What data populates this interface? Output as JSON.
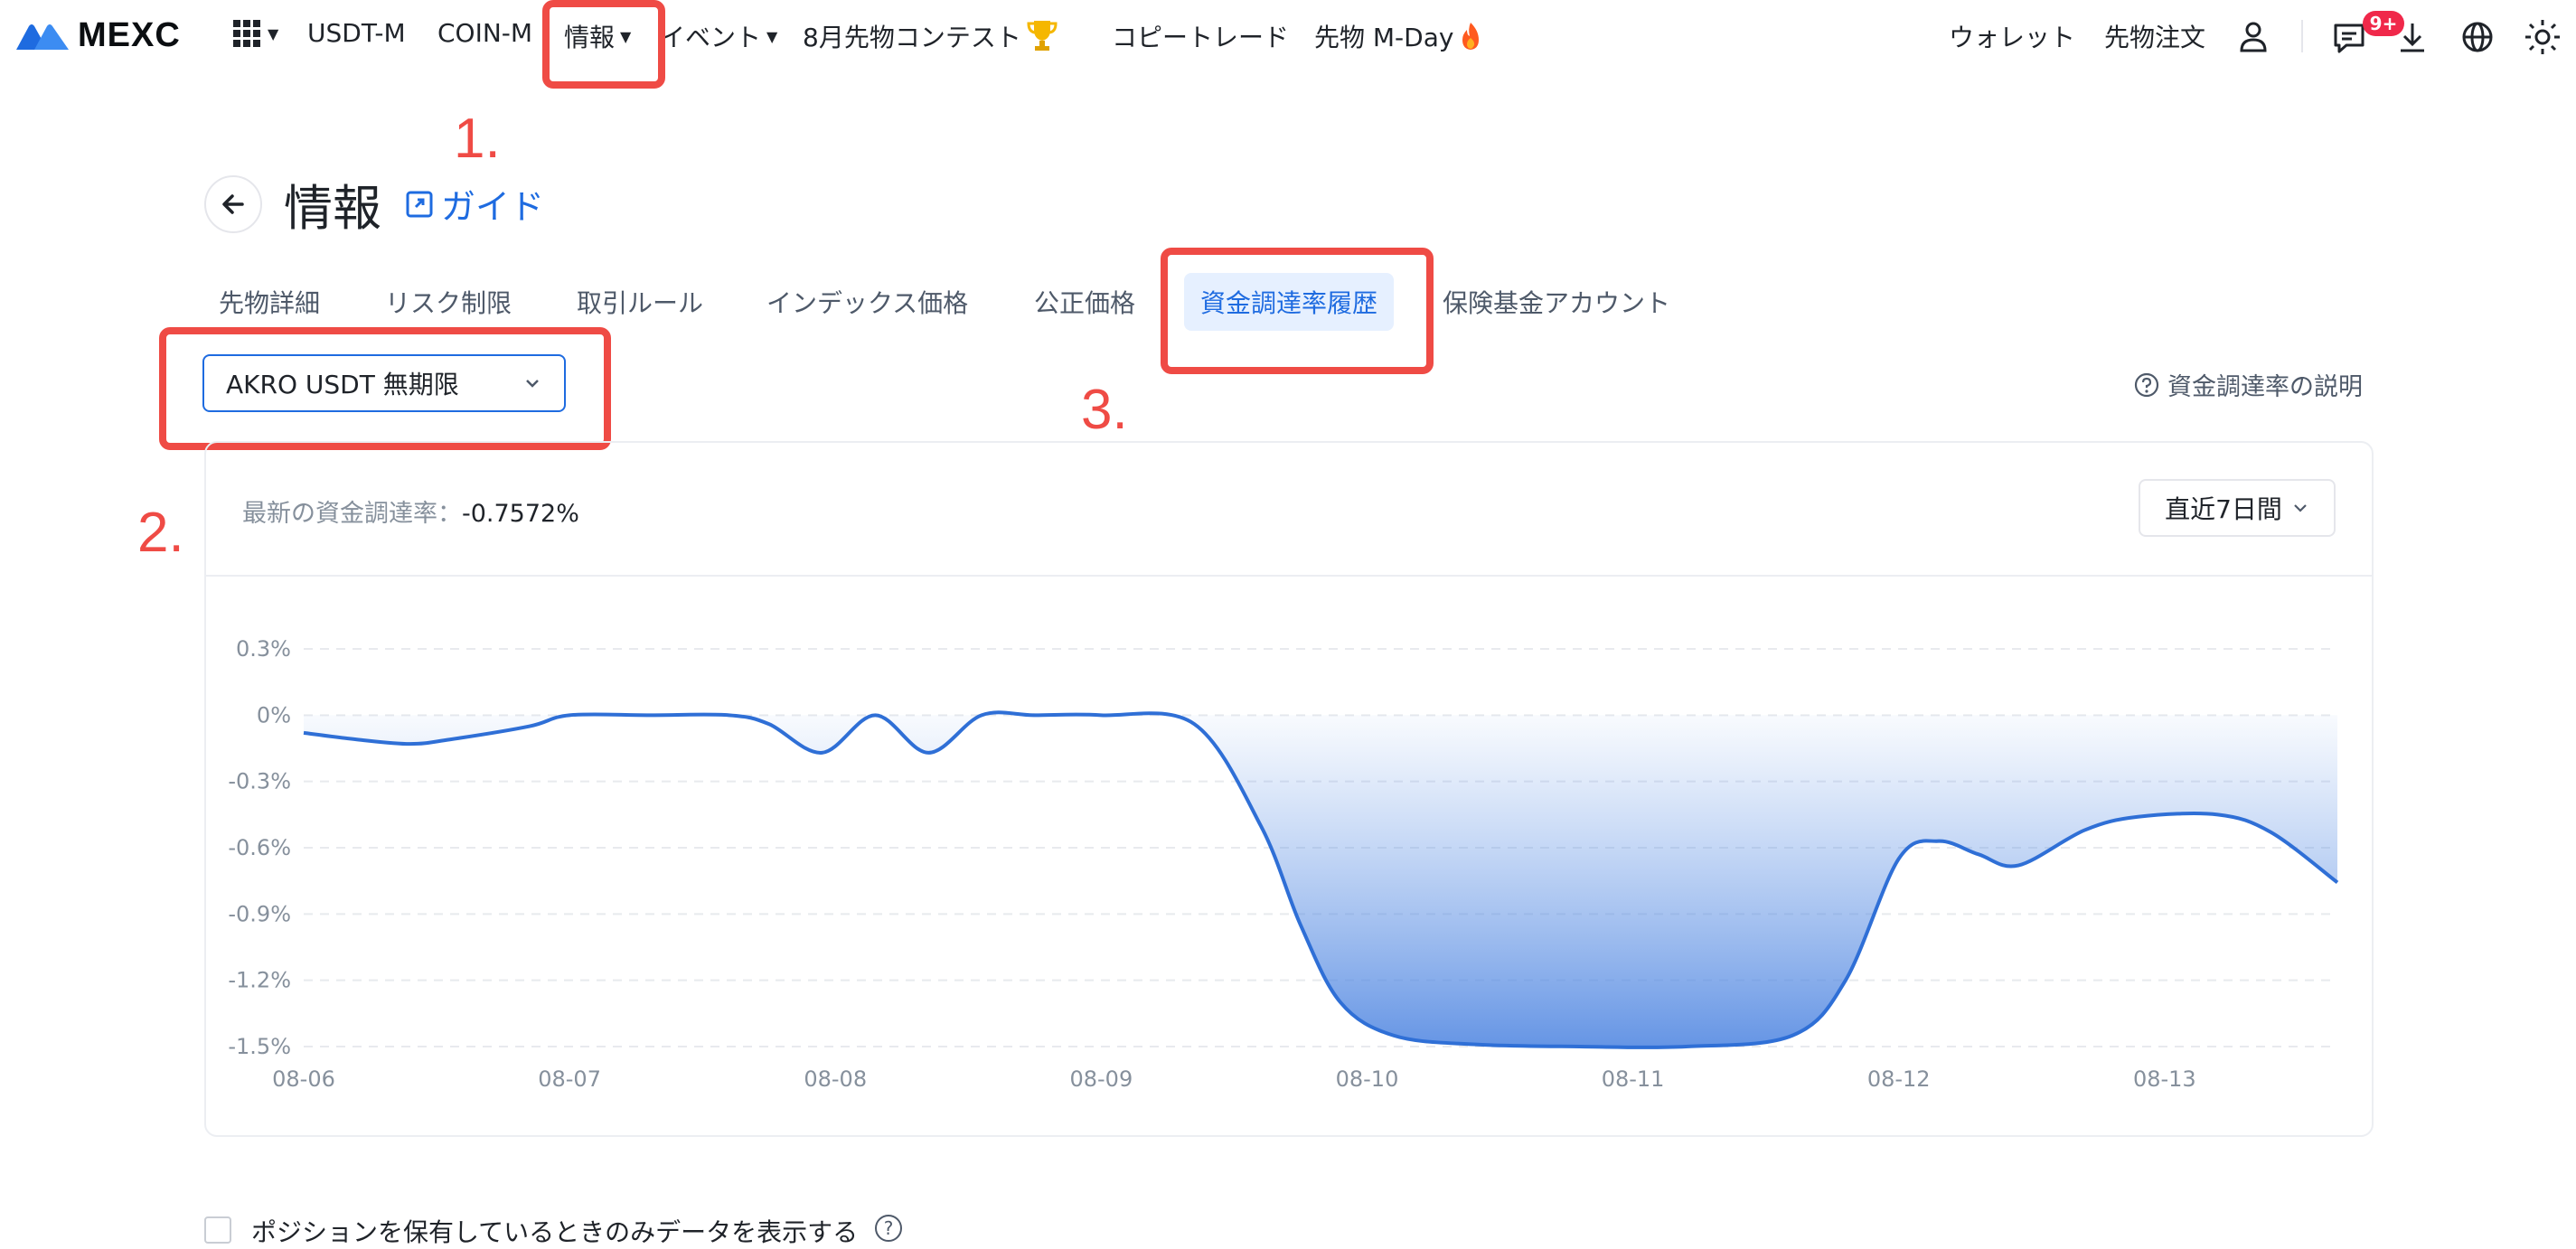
{
  "nav": {
    "logo": "MEXC",
    "items": [
      "USDT-M",
      "COIN-M",
      "情報",
      "イベント",
      "8月先物コンテスト",
      "コピートレード",
      "先物 M-Day"
    ],
    "right": [
      "ウォレット",
      "先物注文"
    ],
    "badge": "9+"
  },
  "annotations": [
    "1.",
    "2.",
    "3."
  ],
  "header": {
    "title": "情報",
    "guide": "ガイド"
  },
  "tabs": [
    "先物詳細",
    "リスク制限",
    "取引ルール",
    "インデックス価格",
    "公正価格",
    "資金調達率履歴",
    "保険基金アカウント"
  ],
  "active_tab_index": 5,
  "symbol_select": {
    "value": "AKRO USDT 無期限"
  },
  "help_link": "資金調達率の説明",
  "latest": {
    "label": "最新の資金調達率：",
    "value": "-0.7572%"
  },
  "period_select": "直近7日間",
  "colors": {
    "accent": "#1e6be0",
    "annotation": "#ef4b45",
    "line": "#2f6fd6"
  },
  "chart_data": {
    "type": "area",
    "x_ticks": [
      "08-06",
      "08-07",
      "08-08",
      "08-09",
      "08-10",
      "08-11",
      "08-12",
      "08-13"
    ],
    "y_ticks": [
      "0.3%",
      "0%",
      "-0.3%",
      "-0.6%",
      "-0.9%",
      "-1.2%",
      "-1.5%"
    ],
    "ylim": [
      -1.5,
      0.3
    ],
    "x": [
      0,
      0.2,
      0.4,
      0.55,
      0.85,
      1.0,
      1.3,
      1.6,
      1.75,
      1.95,
      2.15,
      2.35,
      2.55,
      2.75,
      3.0,
      3.35,
      3.6,
      3.75,
      3.9,
      4.1,
      4.4,
      4.8,
      5.2,
      5.6,
      5.8,
      6.0,
      6.15,
      6.3,
      6.45,
      6.7,
      6.9,
      7.2,
      7.4,
      7.65
    ],
    "values": [
      -0.08,
      -0.11,
      -0.13,
      -0.11,
      -0.05,
      0.0,
      0.0,
      0.0,
      -0.04,
      -0.17,
      0.0,
      -0.17,
      0.0,
      0.0,
      0.0,
      -0.04,
      -0.5,
      -0.95,
      -1.3,
      -1.45,
      -1.49,
      -1.5,
      -1.5,
      -1.45,
      -1.2,
      -0.65,
      -0.57,
      -0.63,
      -0.68,
      -0.52,
      -0.46,
      -0.45,
      -0.53,
      -0.7572
    ],
    "grid": true
  }
}
